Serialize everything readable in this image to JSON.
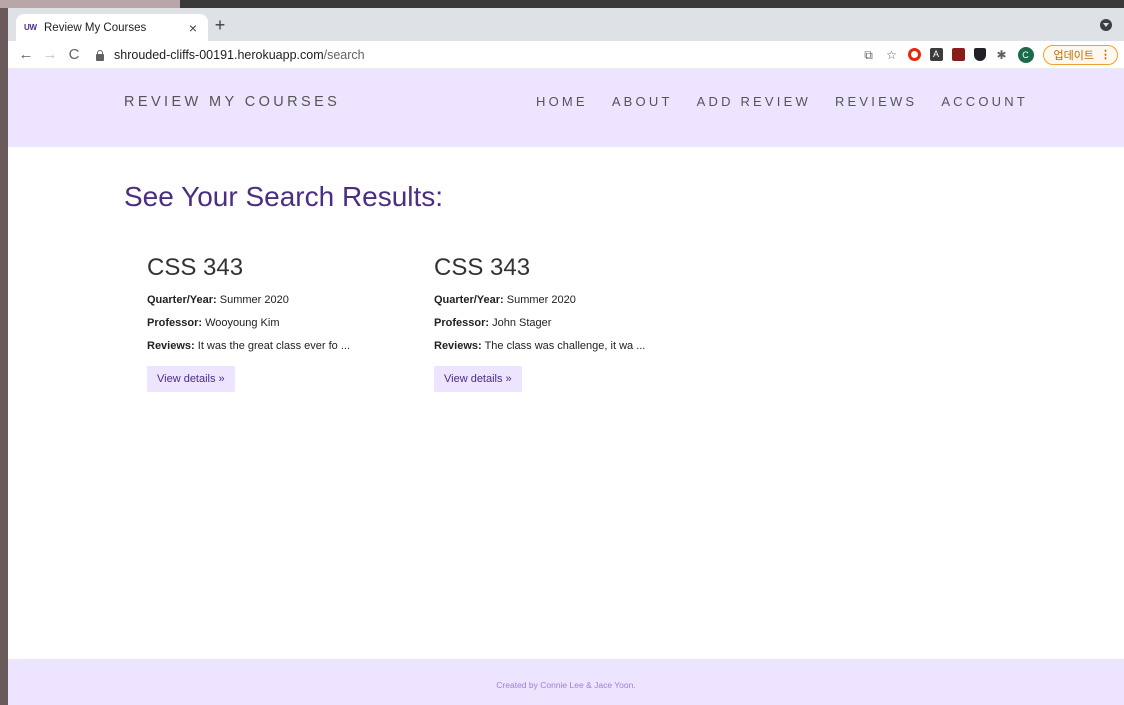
{
  "browser": {
    "tab_favicon": "UW",
    "tab_title": "Review My Courses",
    "tab_close": "×",
    "new_tab": "+",
    "back": "←",
    "forward": "→",
    "reload": "C",
    "url_host": "shrouded-cliffs-00191.herokuapp.com",
    "url_path": "/search",
    "star": "☆",
    "avatar_letter": "C",
    "update_label": "업데이트",
    "menu_dots": "⋮"
  },
  "header": {
    "brand": "REVIEW MY COURSES",
    "nav": [
      "HOME",
      "ABOUT",
      "ADD REVIEW",
      "REVIEWS",
      "ACCOUNT"
    ]
  },
  "main": {
    "heading": "See Your Search Results:",
    "results": [
      {
        "course": "CSS 343",
        "quarter_label": "Quarter/Year:",
        "quarter": "Summer 2020",
        "professor_label": "Professor:",
        "professor": "Wooyoung Kim",
        "reviews_label": "Reviews:",
        "reviews": "It was the great class ever fo ...",
        "button": "View details »"
      },
      {
        "course": "CSS 343",
        "quarter_label": "Quarter/Year:",
        "quarter": "Summer 2020",
        "professor_label": "Professor:",
        "professor": "John Stager",
        "reviews_label": "Reviews:",
        "reviews": "The class was challenge, it wa ...",
        "button": "View details »"
      }
    ]
  },
  "footer": {
    "text": "Created by Connie Lee & Jace Yoon."
  },
  "colors": {
    "accent": "#4b2e83",
    "header_bg": "#ede4ff",
    "footer_text": "#9e7fd6"
  }
}
